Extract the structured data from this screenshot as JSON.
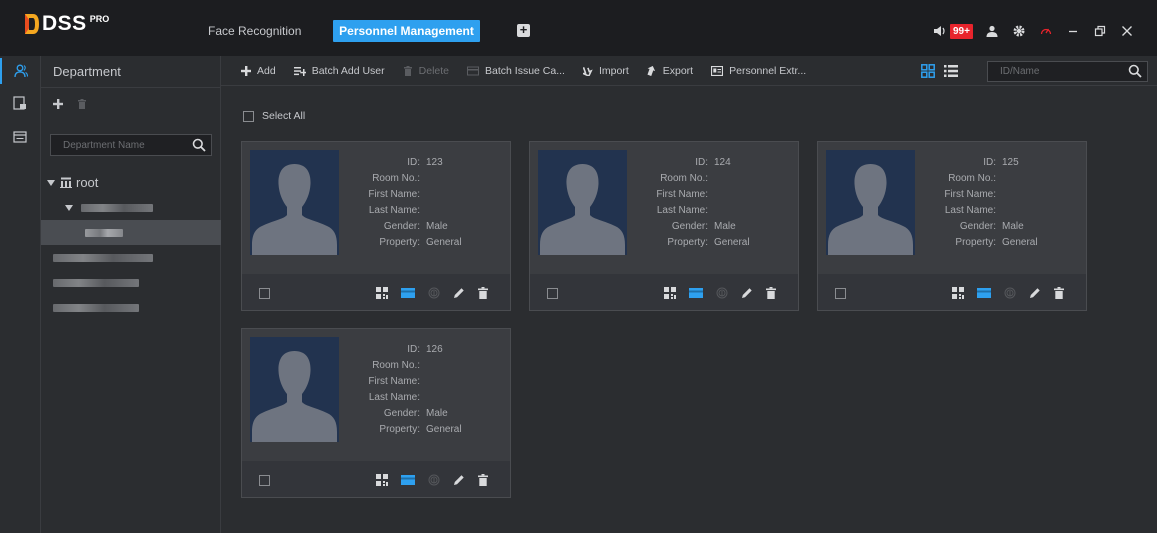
{
  "app": {
    "brand": "DSS",
    "edition": "PRO"
  },
  "tabs": {
    "face": "Face Recognition",
    "personnel": "Personnel Management",
    "add": "+"
  },
  "system": {
    "alarm_count": "99+"
  },
  "dept": {
    "title": "Department",
    "search_placeholder": "Department Name",
    "root_label": "root"
  },
  "toolbar": {
    "add": "Add",
    "batch_add": "Batch Add User",
    "delete": "Delete",
    "batch_issue": "Batch Issue Ca...",
    "import": "Import",
    "export": "Export",
    "personnel_extract": "Personnel Extr...",
    "search_placeholder": "ID/Name"
  },
  "select_all": "Select All",
  "labels": {
    "id": "ID:",
    "room": "Room No.:",
    "first": "First Name:",
    "last": "Last Name:",
    "gender": "Gender:",
    "property": "Property:"
  },
  "persons": [
    {
      "id": "123",
      "room": "",
      "first": "",
      "last": "",
      "gender": "Male",
      "property": "General"
    },
    {
      "id": "124",
      "room": "",
      "first": "",
      "last": "",
      "gender": "Male",
      "property": "General"
    },
    {
      "id": "125",
      "room": "",
      "first": "",
      "last": "",
      "gender": "Male",
      "property": "General"
    },
    {
      "id": "126",
      "room": "",
      "first": "",
      "last": "",
      "gender": "Male",
      "property": "General"
    }
  ],
  "colors": {
    "accent": "#2ea0ef",
    "alarm": "#e8242c",
    "photo_bg": "#22334f"
  }
}
